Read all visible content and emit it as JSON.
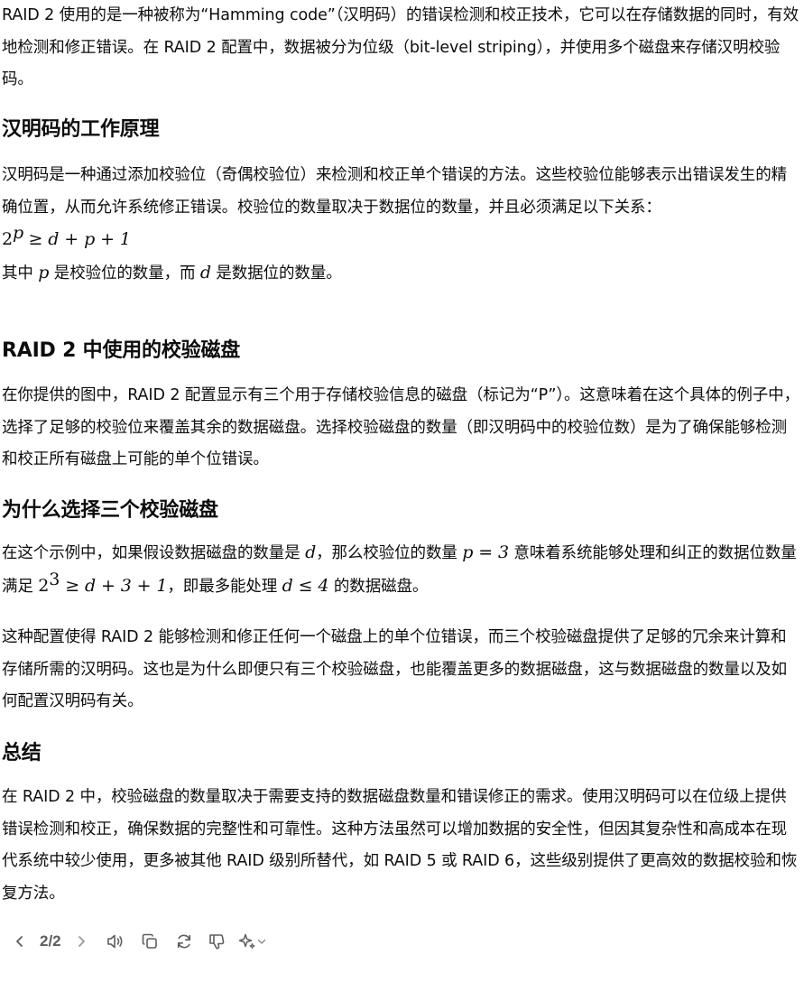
{
  "para_intro": {
    "a": "RAID 2 使用的是一种被称为“Hamming code”（汉明码）的错误检测和校正技术，它可以在存储数据的同时，有效地检测和修正错误。在 RAID 2 配置中，数据被分为位级（bit-level striping），并使用多个磁盘来存储汉明校验码。"
  },
  "section1": {
    "heading": "汉明码的工作原理",
    "text": "汉明码是一种通过添加校验位（奇偶校验位）来检测和校正单个错误的方法。这些校验位能够表示出错误发生的精确位置，从而允许系统修正错误。校验位的数量取决于数据位的数量，并且必须满足以下关系：",
    "formula_base": "2",
    "formula_exp": "p",
    "formula_rest": "≥ d + p + 1",
    "note_a": "其中 ",
    "note_p": "p",
    "note_b": " 是校验位的数量，而 ",
    "note_d": "d",
    "note_c": " 是数据位的数量。"
  },
  "section2": {
    "heading": "RAID 2 中使用的校验磁盘",
    "text": "在你提供的图中，RAID 2 配置显示有三个用于存储校验信息的磁盘（标记为“P”）。这意味着在这个具体的例子中，选择了足够的校验位来覆盖其余的数据磁盘。选择校验磁盘的数量（即汉明码中的校验位数）是为了确保能够检测和校正所有磁盘上可能的单个位错误。"
  },
  "section3": {
    "heading": "为什么选择三个校验磁盘",
    "t1": "在这个示例中，如果假设数据磁盘的数量是 ",
    "m1": "d",
    "t2": "，那么校验位的数量 ",
    "m2": "p = 3",
    "t3": " 意味着系统能够处理和纠正的数据位数量满足 ",
    "m3a": "2",
    "m3exp": "3",
    "m3b": " ≥ d + 3 + 1",
    "t4": "，即最多能处理 ",
    "m4": "d ≤ 4",
    "t5": " 的数据磁盘。",
    "para2": "这种配置使得 RAID 2 能够检测和修正任何一个磁盘上的单个位错误，而三个校验磁盘提供了足够的冗余来计算和存储所需的汉明码。这也是为什么即便只有三个校验磁盘，也能覆盖更多的数据磁盘，这与数据磁盘的数量以及如何配置汉明码有关。"
  },
  "section4": {
    "heading": "总结",
    "text": "在 RAID 2 中，校验磁盘的数量取决于需要支持的数据磁盘数量和错误修正的需求。使用汉明码可以在位级上提供错误检测和校正，确保数据的完整性和可靠性。这种方法虽然可以增加数据的安全性，但因其复杂性和高成本在现代系统中较少使用，更多被其他 RAID 级别所替代，如 RAID 5 或 RAID 6，这些级别提供了更高效的数据校验和恢复方法。"
  },
  "toolbar": {
    "counter": "2/2",
    "icons": [
      "chevron-left-icon",
      "chevron-right-icon",
      "speaker-icon",
      "copy-icon",
      "regenerate-icon",
      "thumbs-down-icon",
      "sparkle-icon",
      "chevron-down-icon"
    ]
  }
}
